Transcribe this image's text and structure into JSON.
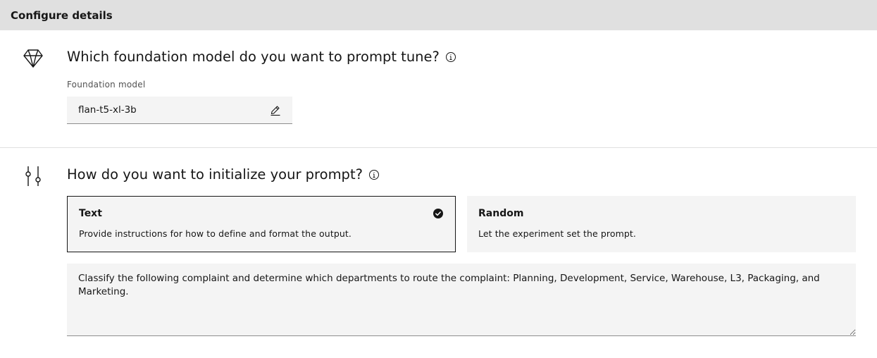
{
  "header": {
    "title": "Configure details"
  },
  "model_section": {
    "icon": "diamond-icon",
    "heading": "Which foundation model do you want to prompt tune?",
    "field_label": "Foundation model",
    "field_value": "flan-t5-xl-3b"
  },
  "prompt_section": {
    "icon": "sliders-icon",
    "heading": "How do you want to initialize your prompt?",
    "tiles": [
      {
        "title": "Text",
        "description": "Provide instructions for how to define and format the output.",
        "selected": true
      },
      {
        "title": "Random",
        "description": "Let the experiment set the prompt.",
        "selected": false
      }
    ],
    "prompt_text": "Classify the following complaint and determine which departments to route the complaint: Planning, Development, Service, Warehouse, L3, Packaging, and Marketing."
  }
}
